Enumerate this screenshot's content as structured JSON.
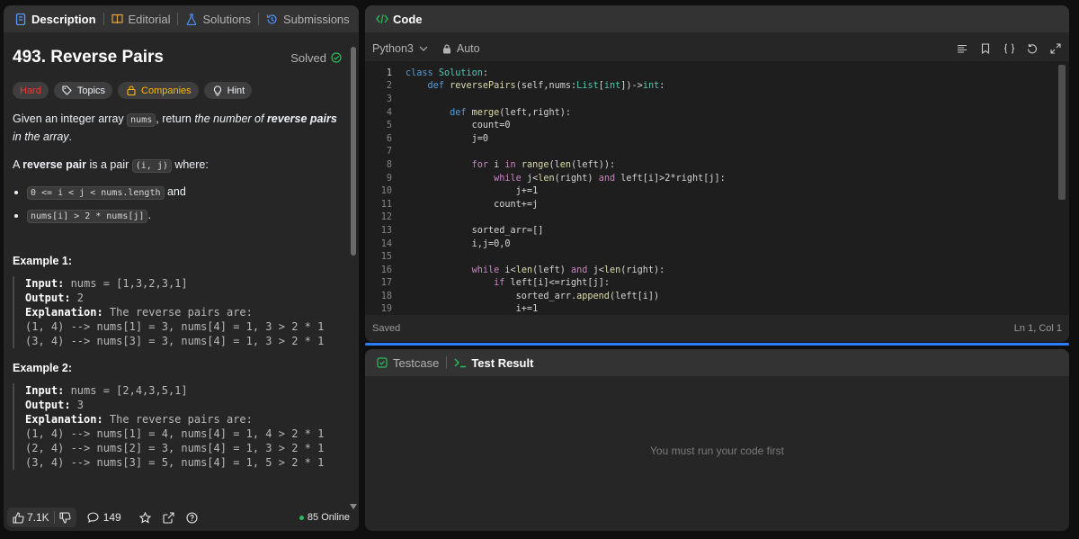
{
  "left_tabs": {
    "description": "Description",
    "editorial": "Editorial",
    "solutions": "Solutions",
    "submissions": "Submissions"
  },
  "problem": {
    "title": "493. Reverse Pairs",
    "status": "Solved",
    "difficulty": "Hard",
    "tags": [
      "Topics",
      "Companies",
      "Hint"
    ],
    "statement": {
      "p1_pre": "Given an integer array ",
      "p1_code": "nums",
      "p1_mid": ", return ",
      "p1_italic": "the number of ",
      "p1_bold": "reverse pairs",
      "p1_end": " in the array",
      "p1_dot": ".",
      "p2_pre": "A ",
      "p2_bold": "reverse pair",
      "p2_mid": " is a pair ",
      "p2_code": "(i, j)",
      "p2_end": " where:",
      "b1_code": "0 <= i < j < nums.length",
      "b1_end": " and",
      "b2_code": "nums[i] > 2 * nums[j]",
      "b2_end": "."
    },
    "examples": [
      {
        "heading": "Example 1:",
        "input_label": "Input:",
        "input": " nums = [1,3,2,3,1]",
        "output_label": "Output:",
        "output": " 2",
        "explanation_label": "Explanation:",
        "explanation": " The reverse pairs are:",
        "lines": [
          "(1, 4) --> nums[1] = 3, nums[4] = 1, 3 > 2 * 1",
          "(3, 4) --> nums[3] = 3, nums[4] = 1, 3 > 2 * 1"
        ]
      },
      {
        "heading": "Example 2:",
        "input_label": "Input:",
        "input": " nums = [2,4,3,5,1]",
        "output_label": "Output:",
        "output": " 3",
        "explanation_label": "Explanation:",
        "explanation": " The reverse pairs are:",
        "lines": [
          "(1, 4) --> nums[1] = 4, nums[4] = 1, 4 > 2 * 1",
          "(2, 4) --> nums[2] = 3, nums[4] = 1, 3 > 2 * 1",
          "(3, 4) --> nums[3] = 5, nums[4] = 1, 5 > 2 * 1"
        ]
      }
    ]
  },
  "footer": {
    "likes": "7.1K",
    "comments": "149",
    "online": "85 Online"
  },
  "code_panel": {
    "tab": "Code",
    "language": "Python3",
    "mode": "Auto",
    "status_left": "Saved",
    "status_right": "Ln 1, Col 1",
    "lines": [
      "class Solution:",
      "    def reversePairs(self,nums:List[int])->int:",
      "",
      "        def merge(left,right):",
      "            count=0",
      "            j=0",
      "",
      "            for i in range(len(left)):",
      "                while j<len(right) and left[i]>2*right[j]:",
      "                    j+=1",
      "                count+=j",
      "",
      "            sorted_arr=[]",
      "            i,j=0,0",
      "",
      "            while i<len(left) and j<len(right):",
      "                if left[i]<=right[j]:",
      "                    sorted_arr.append(left[i])",
      "                    i+=1"
    ]
  },
  "bottom_panel": {
    "tab_testcase": "Testcase",
    "tab_result": "Test Result",
    "empty_message": "You must run your code first"
  },
  "colors": {
    "accent_blue": "#2b7fff",
    "hard": "#f63636",
    "companies": "#ffb800",
    "solved_green": "#2cbb5d"
  }
}
